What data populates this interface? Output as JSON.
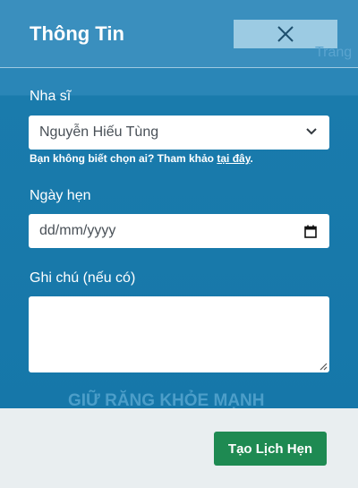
{
  "modal": {
    "title": "Thông Tin"
  },
  "background": {
    "nav_link": "Trang",
    "watermark": "GIỮ RĂNG KHỎE MẠNH"
  },
  "form": {
    "dentist": {
      "label": "Nha sĩ",
      "selected": "Nguyễn Hiếu Tùng",
      "hint_text": "Bạn không biết chọn ai? Tham khảo ",
      "hint_link": "tại đây",
      "hint_end": "."
    },
    "date": {
      "label": "Ngày hẹn",
      "placeholder": "dd/mm/yyyy"
    },
    "note": {
      "label": "Ghi chú (nếu có)",
      "value": ""
    }
  },
  "footer": {
    "submit_label": "Tạo Lịch Hẹn"
  },
  "colors": {
    "header": "#3a8fbe",
    "body": "#1677a9",
    "close_button": "#9ccbe3",
    "submit_button": "#1e8a52",
    "footer": "#e9eef0"
  },
  "icons": {
    "close": "close-icon",
    "dropdown": "chevron-down-icon",
    "calendar": "calendar-icon",
    "resize": "resize-grip-icon"
  }
}
